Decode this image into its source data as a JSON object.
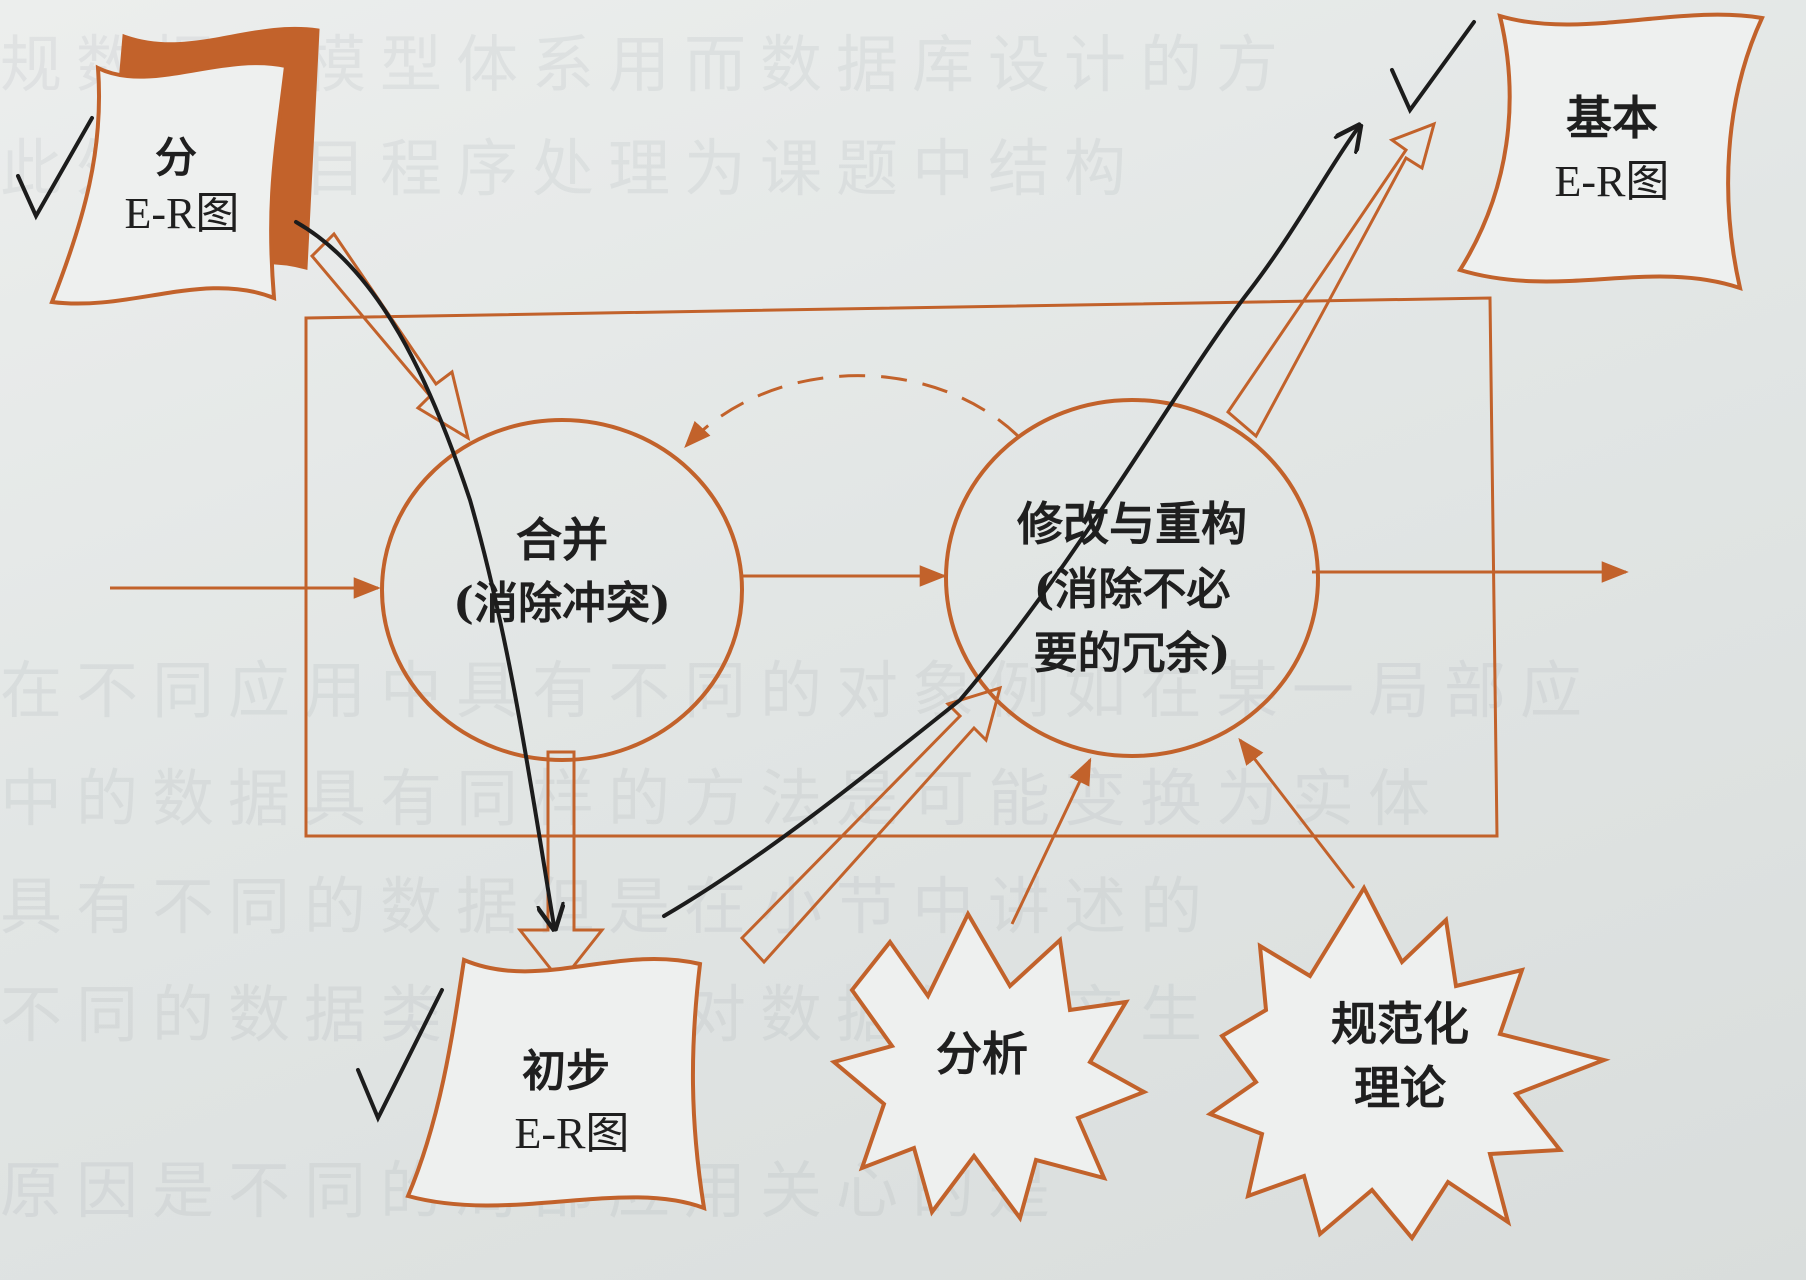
{
  "colors": {
    "diagram_line": "#c2622b",
    "pen_annotation": "#1c1c1c",
    "label_text": "#1f1f1f"
  },
  "nodes": {
    "sub_er": {
      "line1": "分",
      "line2": "E-R图"
    },
    "initial_er": {
      "line1": "初步",
      "line2": "E-R图"
    },
    "basic_er": {
      "line1": "基本",
      "line2": "E-R图"
    },
    "merge": {
      "line1": "合并",
      "line2": "(消除冲突)"
    },
    "refactor": {
      "line1": "修改与重构",
      "line2": "(消除不必",
      "line3": "要的冗余)"
    },
    "analysis": {
      "line1": "分析"
    },
    "normalization": {
      "line1": "规范化",
      "line2": "理论"
    }
  },
  "annotations": {
    "checkmark": "✓"
  }
}
